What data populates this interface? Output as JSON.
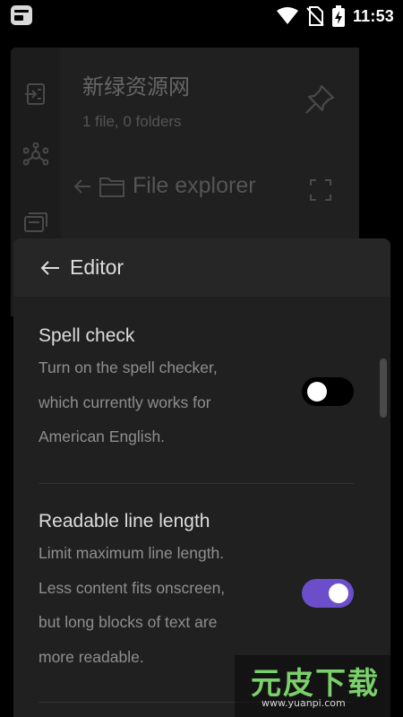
{
  "status_bar": {
    "time": "11:53",
    "icons": [
      "app-icon",
      "wifi-icon",
      "no-sim-icon",
      "battery-charging-icon"
    ]
  },
  "background": {
    "ribbon_icons": [
      "open-vault-icon",
      "graph-view-icon",
      "command-palette-icon"
    ],
    "vault_title": "新绿资源网",
    "vault_meta": "1 file, 0 folders",
    "file_explorer_label": "File explorer",
    "icons": [
      "pin-icon",
      "back-arrow-icon",
      "folder-icon",
      "expand-icon"
    ]
  },
  "modal": {
    "title": "Editor",
    "settings": [
      {
        "name": "Spell check",
        "description": [
          "Turn on the spell checker,",
          "which currently works for",
          "American English."
        ],
        "enabled": false
      },
      {
        "name": "Readable line length",
        "description": [
          "Limit maximum line length.",
          "Less content fits onscreen,",
          "but long blocks of text are",
          "more readable."
        ],
        "enabled": true
      }
    ]
  },
  "colors": {
    "accent": "#6c4ecb",
    "modal_bg": "#202020",
    "header_bg": "#262626"
  },
  "watermark": {
    "main": "元皮下载",
    "url": "www.yuanpi.com"
  }
}
